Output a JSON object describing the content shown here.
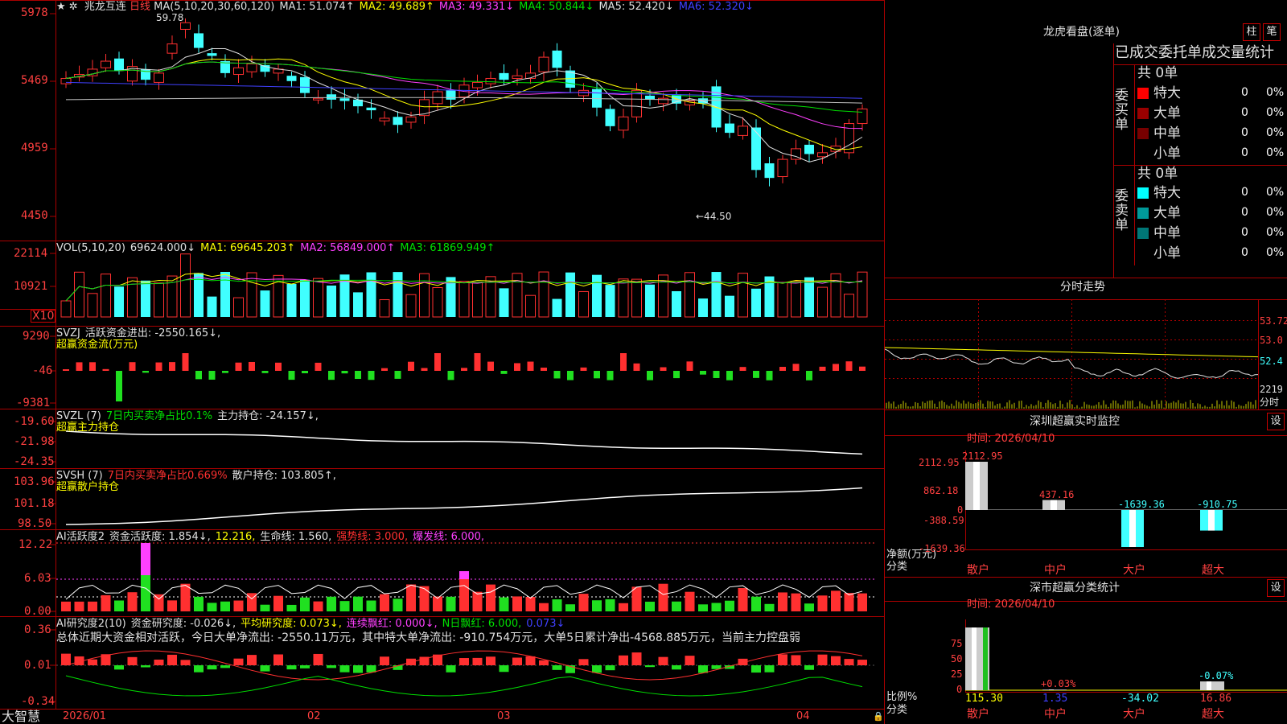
{
  "colors": {
    "up": "#ff3030",
    "down": "#40ffff",
    "grid": "#aa0000",
    "bg": "#000000"
  },
  "main_chart": {
    "star": "★",
    "title": "兆龙互连",
    "period": "日线",
    "ma_legend": [
      {
        "text": "MA(5,10,20,30,60,120)",
        "color": "#e0e0e0"
      },
      {
        "text": "MA1: 51.074↑",
        "color": "#e0e0e0"
      },
      {
        "text": "MA2: 49.689↑",
        "color": "#ffff00"
      },
      {
        "text": "MA3: 49.331↓",
        "color": "#ff40ff"
      },
      {
        "text": "MA4: 50.844↓",
        "color": "#00e000"
      },
      {
        "text": "MA5: 52.420↓",
        "color": "#e0e0e0"
      },
      {
        "text": "MA6: 52.320↓",
        "color": "#4040ff"
      }
    ],
    "y_ticks": [
      "5978",
      "5469",
      "4959",
      "4450"
    ],
    "high_label": "59.78",
    "low_label": "←44.50"
  },
  "vol_panel": {
    "legend": [
      {
        "text": "VOL(5,10,20)",
        "color": "#e0e0e0"
      },
      {
        "text": "69624.000↓",
        "color": "#e0e0e0"
      },
      {
        "text": "MA1: 69645.203↑",
        "color": "#ffff00"
      },
      {
        "text": "MA2: 56849.000↑",
        "color": "#ff40ff"
      },
      {
        "text": "MA3: 61869.949↑",
        "color": "#00e000"
      }
    ],
    "y_ticks": [
      "22114",
      "10921"
    ],
    "unit": "X10"
  },
  "svzj_panel": {
    "legend": [
      {
        "text": "SVZJ",
        "color": "#e0e0e0"
      },
      {
        "text": "活跃资金进出: -2550.165↓,",
        "color": "#e0e0e0"
      }
    ],
    "subtitle": "超赢资金流(万元)",
    "y_ticks": [
      "9290",
      "-46",
      "-9381"
    ]
  },
  "svzl_panel": {
    "legend": [
      {
        "text": "SVZL (7)",
        "color": "#e0e0e0"
      },
      {
        "text": "7日内买卖净占比0.1%",
        "color": "#00e000"
      },
      {
        "text": "主力持仓: -24.157↓,",
        "color": "#e0e0e0"
      }
    ],
    "subtitle": "超赢主力持仓",
    "y_ticks": [
      "-19.60",
      "-21.98",
      "-24.35"
    ]
  },
  "svsh_panel": {
    "legend": [
      {
        "text": "SVSH (7)",
        "color": "#e0e0e0"
      },
      {
        "text": "7日内买卖净占比0.669%",
        "color": "#ff3030"
      },
      {
        "text": "散户持仓: 103.805↑,",
        "color": "#e0e0e0"
      }
    ],
    "subtitle": "超赢散户持仓",
    "y_ticks": [
      "103.96",
      "101.18",
      "98.50"
    ]
  },
  "ai_active_panel": {
    "legend": [
      {
        "text": "AI活跃度2",
        "color": "#e0e0e0"
      },
      {
        "text": "资金活跃度: 1.854↓,",
        "color": "#e0e0e0"
      },
      {
        "text": "12.216,",
        "color": "#ffff00"
      },
      {
        "text": "生命线: 1.560,",
        "color": "#e0e0e0"
      },
      {
        "text": "强势线: 3.000,",
        "color": "#ff3030"
      },
      {
        "text": "爆发线: 6.000,",
        "color": "#ff40ff"
      }
    ],
    "y_ticks": [
      "12.22",
      "6.03",
      "0.00"
    ]
  },
  "ai_research_panel": {
    "legend": [
      {
        "text": "AI研究度2(10)",
        "color": "#e0e0e0"
      },
      {
        "text": "资金研究度: -0.026↓,",
        "color": "#e0e0e0"
      },
      {
        "text": "平均研究度: 0.073↓,",
        "color": "#ffff00"
      },
      {
        "text": "连续飘红: 0.000↓,",
        "color": "#ff40ff"
      },
      {
        "text": "N日飘红: 6.000,",
        "color": "#00e000"
      },
      {
        "text": "0.073↓",
        "color": "#4040ff"
      }
    ],
    "summary": "总体近期大资金相对活跃，今日大单净流出: -2550.11万元，其中特大单净流出: -910.754万元，大单5日累计净出-4568.885万元，当前主力控盘弱",
    "y_ticks": [
      "0.36",
      "0.01",
      "-0.34"
    ]
  },
  "x_axis": {
    "brand": "大智慧",
    "labels": [
      "2026/01",
      "02",
      "03",
      "04"
    ]
  },
  "right_panel": {
    "dragon_title": "龙虎看盘(逐单)",
    "btn_column": "柱",
    "btn_count": "笔",
    "stats_header": "已成交委托单成交量统计",
    "buy_label": "委买单",
    "sell_label": "委卖单",
    "buy_total": "共 0单",
    "sell_total": "共 0单",
    "buy_rows": [
      {
        "name": "特大",
        "count": "0",
        "pct": "0%",
        "color": "#ff0000"
      },
      {
        "name": "大单",
        "count": "0",
        "pct": "0%",
        "color": "#990000"
      },
      {
        "name": "中单",
        "count": "0",
        "pct": "0%",
        "color": "#770000"
      },
      {
        "name": "小单",
        "count": "0",
        "pct": "0%",
        "color": ""
      }
    ],
    "sell_rows": [
      {
        "name": "特大",
        "count": "0",
        "pct": "0%",
        "color": "#00ffff"
      },
      {
        "name": "大单",
        "count": "0",
        "pct": "0%",
        "color": "#009999"
      },
      {
        "name": "中单",
        "count": "0",
        "pct": "0%",
        "color": "#007777"
      },
      {
        "name": "小单",
        "count": "0",
        "pct": "0%",
        "color": ""
      }
    ],
    "intraday_title": "分时走势",
    "intraday_ticks": [
      "53.72",
      "53.0",
      "52.4"
    ],
    "intraday_vol_tick": "2219",
    "intraday_footer": "分时",
    "monitor": {
      "title": "深圳超赢实时监控",
      "settings": "设",
      "time": "时间: 2026/04/10",
      "y_ticks": [
        "2112.95",
        "862.18",
        "0",
        "-388.59",
        "-1639.36"
      ],
      "axis_label1": "净额(万元)",
      "axis_label2": "分类",
      "bars": [
        {
          "cat": "散户",
          "value": "2112.95",
          "num": 2112.95
        },
        {
          "cat": "中户",
          "value": "437.16",
          "num": 437.16
        },
        {
          "cat": "大户",
          "value": "-1639.36",
          "num": -1639.36
        },
        {
          "cat": "超大",
          "value": "-910.75",
          "num": -910.75
        }
      ]
    },
    "classify": {
      "title": "深市超赢分类统计",
      "settings": "设",
      "time": "时间: 2026/04/10",
      "y_ticks": [
        "75",
        "50",
        "25",
        "0"
      ],
      "axis_label1": "比例%",
      "axis_label2": "分类",
      "bars": [
        {
          "cat": "散户",
          "top": "",
          "bottom": "115.30",
          "pct": 100
        },
        {
          "cat": "中户",
          "top": "+0.03%",
          "bottom": "1.35",
          "pct": 1
        },
        {
          "cat": "大户",
          "top": "",
          "bottom": "-34.02",
          "pct": 0
        },
        {
          "cat": "超大",
          "top": "-0.07%",
          "bottom": "16.86",
          "pct": 14
        }
      ]
    }
  }
}
